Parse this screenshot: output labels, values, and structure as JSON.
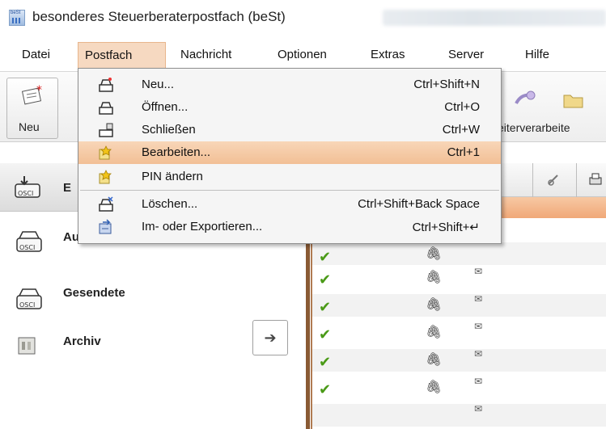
{
  "window": {
    "title": "besonderes Steuerberaterpostfach (beSt)",
    "icon_text": "beSt"
  },
  "menubar": {
    "items": [
      {
        "label": "Datei"
      },
      {
        "label": "Postfach"
      },
      {
        "label": "Nachricht"
      },
      {
        "label": "Optionen"
      },
      {
        "label": "Extras"
      },
      {
        "label": "Server"
      },
      {
        "label": "Hilfe"
      }
    ],
    "active_item": "Postfach"
  },
  "toolbar": {
    "new_label": "Neu",
    "forward_label": "eiterverarbeite"
  },
  "postfach_menu": {
    "items": [
      {
        "label": "Neu...",
        "shortcut": "Ctrl+Shift+N",
        "icon": "new-mailbox-icon"
      },
      {
        "label": "Öffnen...",
        "shortcut": "Ctrl+O",
        "icon": "open-mailbox-icon"
      },
      {
        "label": "Schließen",
        "shortcut": "Ctrl+W",
        "icon": "close-mailbox-icon"
      },
      {
        "label": "Bearbeiten...",
        "shortcut": "Ctrl+1",
        "icon": "edit-mailbox-icon",
        "highlighted": true
      },
      {
        "label": "PIN ändern",
        "shortcut": "",
        "icon": "change-pin-icon"
      },
      {
        "label": "Löschen...",
        "shortcut": "Ctrl+Shift+Back Space",
        "icon": "delete-mailbox-icon"
      },
      {
        "label": "Im- oder Exportieren...",
        "shortcut": "Ctrl+Shift+↵",
        "icon": "import-export-icon"
      }
    ]
  },
  "folders": {
    "items": [
      {
        "label": "E",
        "icon": "inbox-icon"
      },
      {
        "label": "Ausgang",
        "icon": "outbox-icon"
      },
      {
        "label": "Gesendete",
        "icon": "sent-icon"
      },
      {
        "label": "Archiv",
        "icon": "archive-icon"
      }
    ],
    "icon_caption": "OSCI",
    "move_arrow": "➔"
  },
  "message_list": {
    "check_glyph": "✔",
    "attachment_glyph": "🖇",
    "envelope_glyph": "✉",
    "rows": 8
  },
  "colors": {
    "menu_highlight": "#f2bf95",
    "active_menu_bg": "#f6d9c1",
    "list_divider": "#8a5a34",
    "check_green": "#4a9a17"
  }
}
